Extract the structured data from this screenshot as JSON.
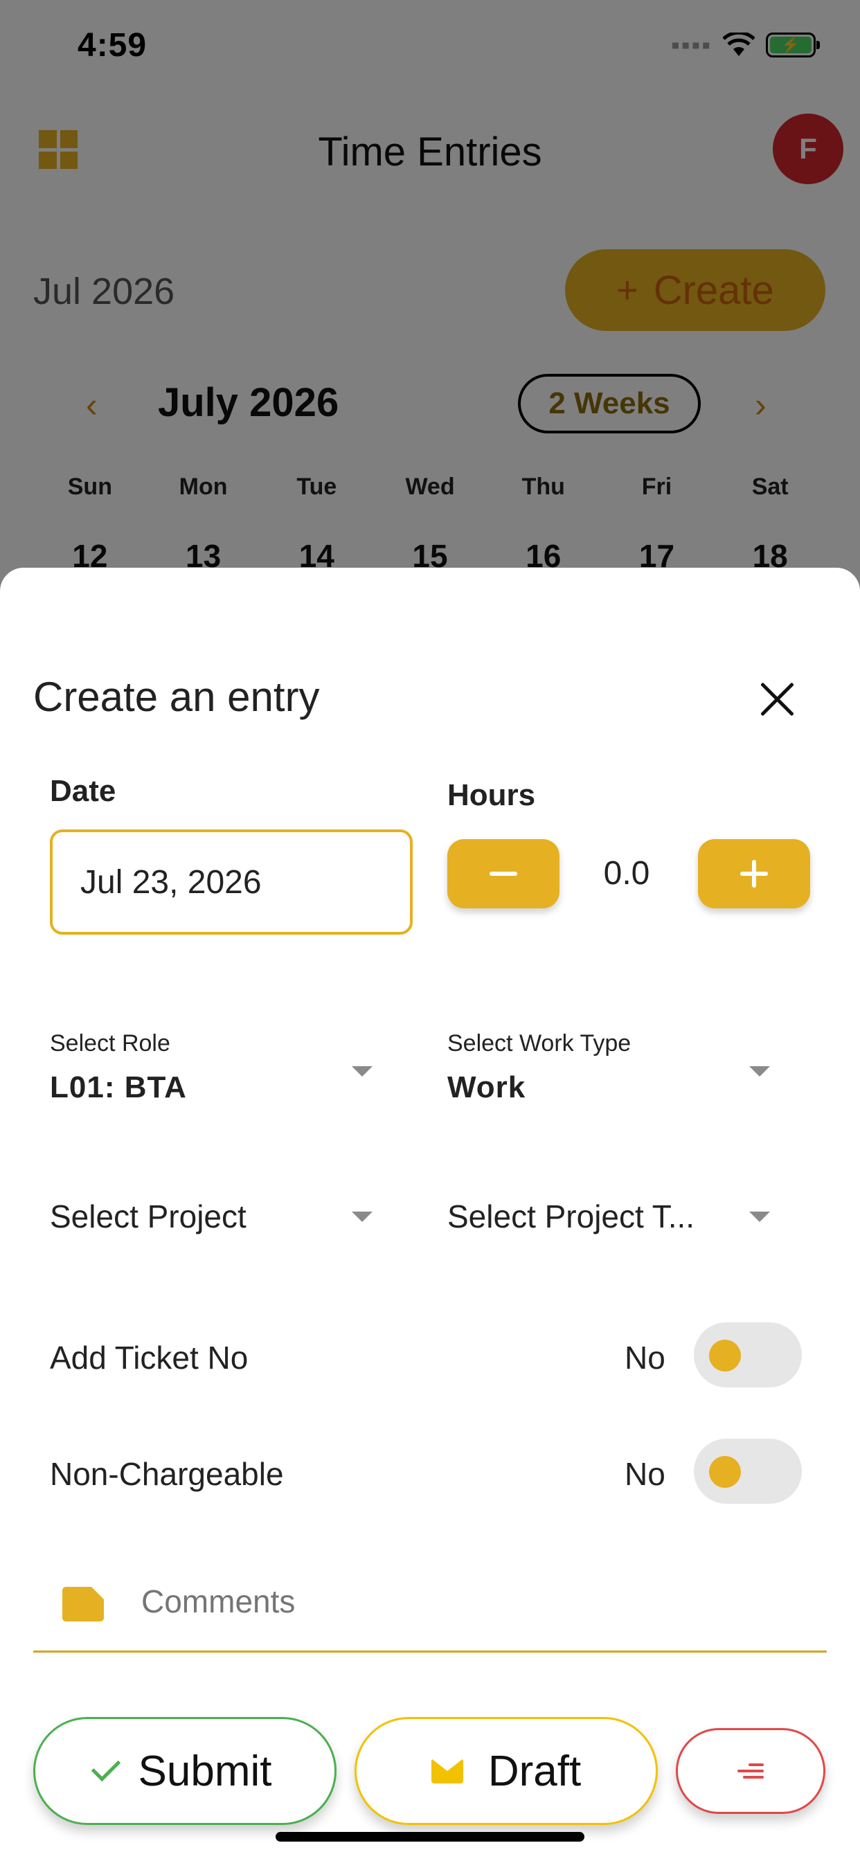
{
  "status_bar": {
    "time": "4:59"
  },
  "header": {
    "title": "Time Entries",
    "avatar_initial": "F"
  },
  "calendar_header": {
    "month_label": "Jul 2026",
    "create_label": "Create",
    "calendar_month": "July 2026",
    "range_label": "2 Weeks",
    "weekdays": [
      "Sun",
      "Mon",
      "Tue",
      "Wed",
      "Thu",
      "Fri",
      "Sat"
    ],
    "days": [
      "12",
      "13",
      "14",
      "15",
      "16",
      "17",
      "18"
    ]
  },
  "sheet": {
    "title": "Create an entry",
    "date_label": "Date",
    "date_value": "Jul 23, 2026",
    "hours_label": "Hours",
    "hours_value": "0.0",
    "role": {
      "label": "Select Role",
      "value": "L01: BTA"
    },
    "work_type": {
      "label": "Select Work Type",
      "value": "Work"
    },
    "project_placeholder": "Select Project",
    "project_task_placeholder": "Select Project T...",
    "ticket": {
      "label": "Add Ticket No",
      "value": "No",
      "on": false
    },
    "non_chargeable": {
      "label": "Non-Chargeable",
      "value": "No",
      "on": false
    },
    "comments_placeholder": "Comments"
  },
  "footer": {
    "submit_label": "Submit",
    "draft_label": "Draft"
  },
  "colors": {
    "accent": "#e5b022",
    "submit_border": "#4caf50",
    "draft_border": "#f2c200",
    "menu_border": "#e04848",
    "avatar_bg": "#d2262c"
  }
}
